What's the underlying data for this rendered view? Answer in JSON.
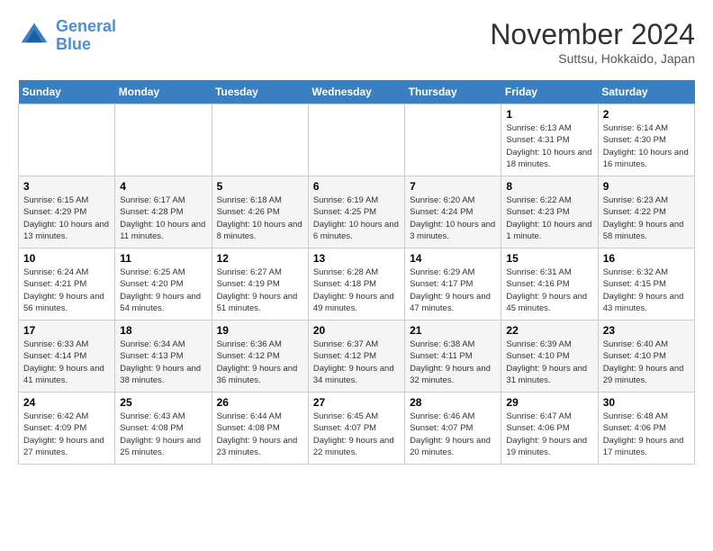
{
  "header": {
    "logo_line1": "General",
    "logo_line2": "Blue",
    "month": "November 2024",
    "location": "Suttsu, Hokkaido, Japan"
  },
  "days_of_week": [
    "Sunday",
    "Monday",
    "Tuesday",
    "Wednesday",
    "Thursday",
    "Friday",
    "Saturday"
  ],
  "weeks": [
    [
      {
        "day": "",
        "info": ""
      },
      {
        "day": "",
        "info": ""
      },
      {
        "day": "",
        "info": ""
      },
      {
        "day": "",
        "info": ""
      },
      {
        "day": "",
        "info": ""
      },
      {
        "day": "1",
        "info": "Sunrise: 6:13 AM\nSunset: 4:31 PM\nDaylight: 10 hours and 18 minutes."
      },
      {
        "day": "2",
        "info": "Sunrise: 6:14 AM\nSunset: 4:30 PM\nDaylight: 10 hours and 16 minutes."
      }
    ],
    [
      {
        "day": "3",
        "info": "Sunrise: 6:15 AM\nSunset: 4:29 PM\nDaylight: 10 hours and 13 minutes."
      },
      {
        "day": "4",
        "info": "Sunrise: 6:17 AM\nSunset: 4:28 PM\nDaylight: 10 hours and 11 minutes."
      },
      {
        "day": "5",
        "info": "Sunrise: 6:18 AM\nSunset: 4:26 PM\nDaylight: 10 hours and 8 minutes."
      },
      {
        "day": "6",
        "info": "Sunrise: 6:19 AM\nSunset: 4:25 PM\nDaylight: 10 hours and 6 minutes."
      },
      {
        "day": "7",
        "info": "Sunrise: 6:20 AM\nSunset: 4:24 PM\nDaylight: 10 hours and 3 minutes."
      },
      {
        "day": "8",
        "info": "Sunrise: 6:22 AM\nSunset: 4:23 PM\nDaylight: 10 hours and 1 minute."
      },
      {
        "day": "9",
        "info": "Sunrise: 6:23 AM\nSunset: 4:22 PM\nDaylight: 9 hours and 58 minutes."
      }
    ],
    [
      {
        "day": "10",
        "info": "Sunrise: 6:24 AM\nSunset: 4:21 PM\nDaylight: 9 hours and 56 minutes."
      },
      {
        "day": "11",
        "info": "Sunrise: 6:25 AM\nSunset: 4:20 PM\nDaylight: 9 hours and 54 minutes."
      },
      {
        "day": "12",
        "info": "Sunrise: 6:27 AM\nSunset: 4:19 PM\nDaylight: 9 hours and 51 minutes."
      },
      {
        "day": "13",
        "info": "Sunrise: 6:28 AM\nSunset: 4:18 PM\nDaylight: 9 hours and 49 minutes."
      },
      {
        "day": "14",
        "info": "Sunrise: 6:29 AM\nSunset: 4:17 PM\nDaylight: 9 hours and 47 minutes."
      },
      {
        "day": "15",
        "info": "Sunrise: 6:31 AM\nSunset: 4:16 PM\nDaylight: 9 hours and 45 minutes."
      },
      {
        "day": "16",
        "info": "Sunrise: 6:32 AM\nSunset: 4:15 PM\nDaylight: 9 hours and 43 minutes."
      }
    ],
    [
      {
        "day": "17",
        "info": "Sunrise: 6:33 AM\nSunset: 4:14 PM\nDaylight: 9 hours and 41 minutes."
      },
      {
        "day": "18",
        "info": "Sunrise: 6:34 AM\nSunset: 4:13 PM\nDaylight: 9 hours and 38 minutes."
      },
      {
        "day": "19",
        "info": "Sunrise: 6:36 AM\nSunset: 4:12 PM\nDaylight: 9 hours and 36 minutes."
      },
      {
        "day": "20",
        "info": "Sunrise: 6:37 AM\nSunset: 4:12 PM\nDaylight: 9 hours and 34 minutes."
      },
      {
        "day": "21",
        "info": "Sunrise: 6:38 AM\nSunset: 4:11 PM\nDaylight: 9 hours and 32 minutes."
      },
      {
        "day": "22",
        "info": "Sunrise: 6:39 AM\nSunset: 4:10 PM\nDaylight: 9 hours and 31 minutes."
      },
      {
        "day": "23",
        "info": "Sunrise: 6:40 AM\nSunset: 4:10 PM\nDaylight: 9 hours and 29 minutes."
      }
    ],
    [
      {
        "day": "24",
        "info": "Sunrise: 6:42 AM\nSunset: 4:09 PM\nDaylight: 9 hours and 27 minutes."
      },
      {
        "day": "25",
        "info": "Sunrise: 6:43 AM\nSunset: 4:08 PM\nDaylight: 9 hours and 25 minutes."
      },
      {
        "day": "26",
        "info": "Sunrise: 6:44 AM\nSunset: 4:08 PM\nDaylight: 9 hours and 23 minutes."
      },
      {
        "day": "27",
        "info": "Sunrise: 6:45 AM\nSunset: 4:07 PM\nDaylight: 9 hours and 22 minutes."
      },
      {
        "day": "28",
        "info": "Sunrise: 6:46 AM\nSunset: 4:07 PM\nDaylight: 9 hours and 20 minutes."
      },
      {
        "day": "29",
        "info": "Sunrise: 6:47 AM\nSunset: 4:06 PM\nDaylight: 9 hours and 19 minutes."
      },
      {
        "day": "30",
        "info": "Sunrise: 6:48 AM\nSunset: 4:06 PM\nDaylight: 9 hours and 17 minutes."
      }
    ]
  ]
}
